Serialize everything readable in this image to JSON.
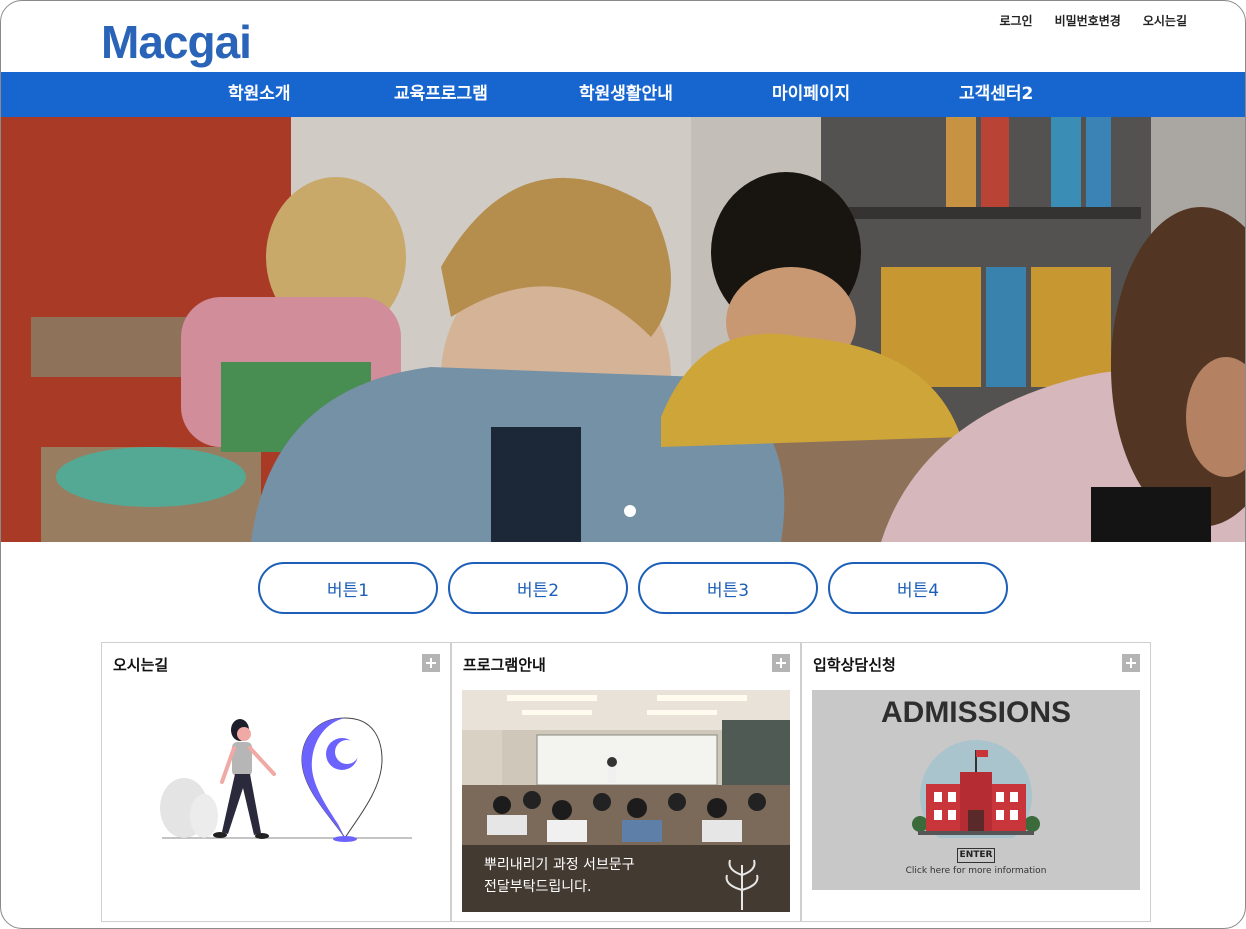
{
  "brand": {
    "logo": "Macgai",
    "color": "#2a64b8"
  },
  "top_links": [
    "로그인",
    "비밀번호변경",
    "오시는길"
  ],
  "nav": {
    "background": "#1766d0",
    "items": [
      "학원소개",
      "교육프로그램",
      "학원생활안내",
      "마이페이지",
      "고객센터2"
    ]
  },
  "hero": {
    "slides_total": 1,
    "active_slide": 1
  },
  "buttons": [
    "버튼1",
    "버튼2",
    "버튼3",
    "버튼4"
  ],
  "cards": [
    {
      "title": "오시는길",
      "icon": "map-pin-illustration"
    },
    {
      "title": "프로그램안내",
      "caption_line1": "뿌리내리기 과정 서브문구",
      "caption_line2": "전달부탁드립니다."
    },
    {
      "title": "입학상담신청",
      "banner_title": "ADMISSIONS",
      "enter_label": "ENTER",
      "more_info": "Click here for more information"
    }
  ]
}
